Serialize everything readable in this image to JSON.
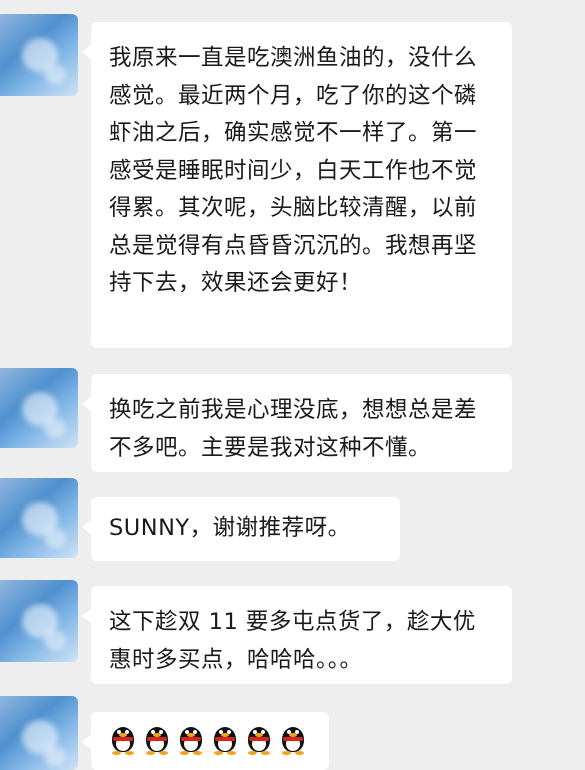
{
  "messages": [
    {
      "text": "我原来一直是吃澳洲鱼油的，没什么感觉。最近两个月，吃了你的这个磷虾油之后，确实感觉不一样了。第一感受是睡眠时间少，白天工作也不觉得累。其次呢，头脑比较清醒，以前总是觉得有点昏昏沉沉的。我想再坚持下去，效果还会更好！"
    },
    {
      "text": "换吃之前我是心理没底，想想总是差不多吧。主要是我对这种不懂。"
    },
    {
      "text": "SUNNY，谢谢推荐呀。"
    },
    {
      "text": "这下趁双 11 要多屯点货了，趁大优惠时多买点，哈哈哈。。。"
    },
    {
      "emojis": [
        "penguin-emoji",
        "penguin-emoji",
        "penguin-emoji",
        "penguin-emoji",
        "penguin-emoji",
        "penguin-emoji"
      ]
    }
  ],
  "colors": {
    "background": "#eeeeee",
    "bubble": "#ffffff",
    "text": "#1a1a1a"
  }
}
